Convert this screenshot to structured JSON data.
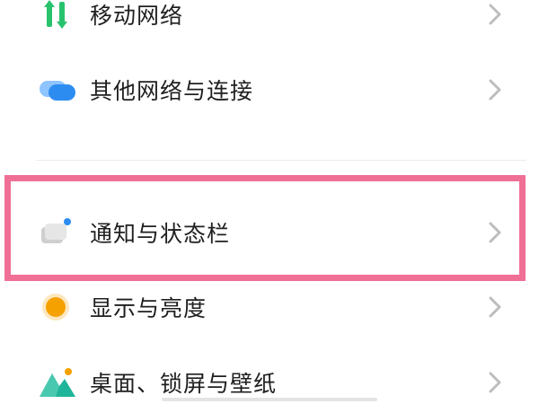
{
  "settings": {
    "items": [
      {
        "label": "移动网络",
        "icon": "mobile-data-icon"
      },
      {
        "label": "其他网络与连接",
        "icon": "connections-icon"
      },
      {
        "label": "通知与状态栏",
        "icon": "notification-icon"
      },
      {
        "label": "显示与亮度",
        "icon": "display-brightness-icon"
      },
      {
        "label": "桌面、锁屏与壁纸",
        "icon": "wallpaper-icon"
      }
    ],
    "highlighted_item": "通知与状态栏"
  },
  "colors": {
    "highlight_border": "#f06f95",
    "mobile_green": "#27c26c",
    "connections_blue": "#2d8cf0",
    "display_orange": "#f5a100",
    "wallpaper_teal": "#1fb59a",
    "chevron_gray": "#bdbdbd"
  }
}
